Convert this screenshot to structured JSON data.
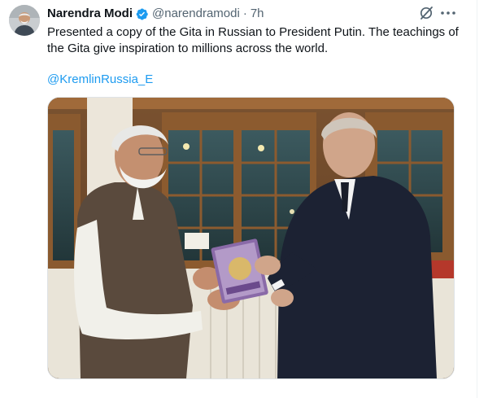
{
  "author": {
    "display_name": "Narendra Modi",
    "handle": "@narendramodi",
    "separator": "·",
    "time": "7h",
    "verified": true,
    "avatar_icon": "profile-photo-avatar"
  },
  "actions": {
    "grok_icon": "grok-icon",
    "more_icon": "more-dots-icon"
  },
  "tweet": {
    "text": "Presented a copy of the Gita in Russian to President Putin. The teachings of the Gita give inspiration to millions across the world.",
    "mention": "@KremlinRussia_E"
  },
  "colors": {
    "text": "#0f1419",
    "secondary": "#536471",
    "link": "#1d9bf0",
    "verified": "#1d9bf0"
  }
}
